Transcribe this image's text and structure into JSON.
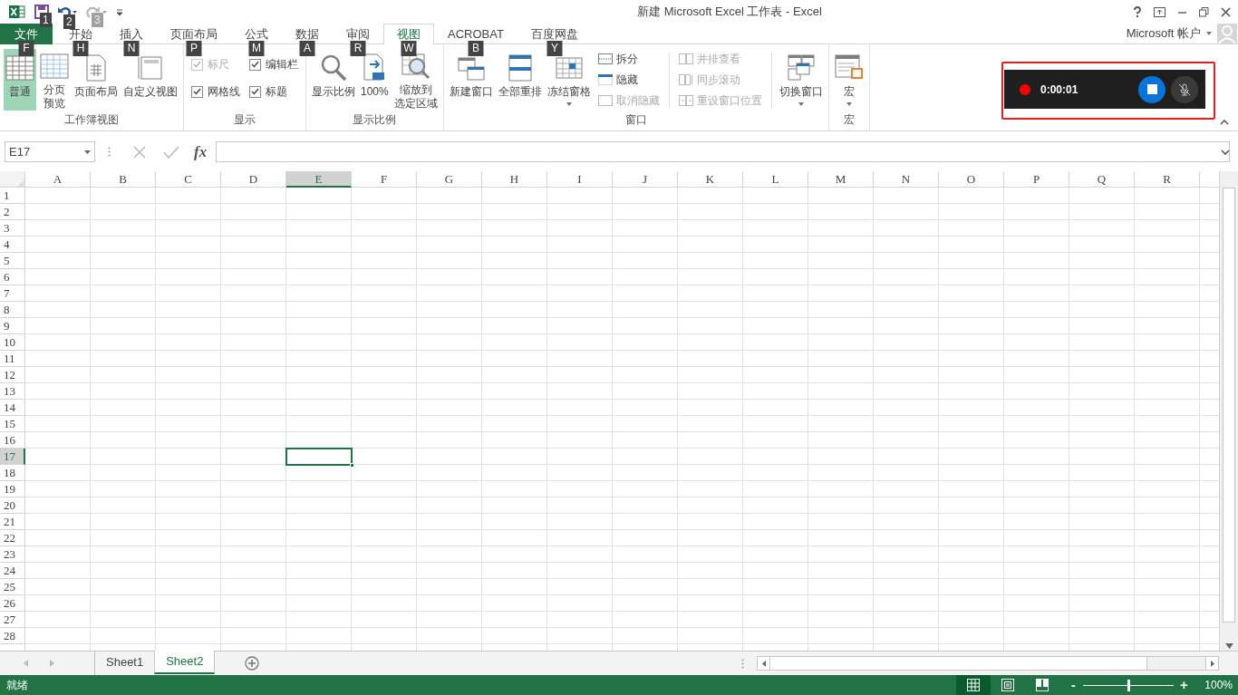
{
  "window": {
    "title": "新建 Microsoft Excel 工作表 - Excel"
  },
  "quick_access": [
    {
      "kind": "save",
      "keytip": "1",
      "disabled": false
    },
    {
      "kind": "undo",
      "keytip": "2",
      "disabled": false
    },
    {
      "kind": "redo",
      "keytip": "3",
      "disabled": true
    }
  ],
  "account": {
    "label": "Microsoft 帐户"
  },
  "tabs": [
    {
      "label": "文件",
      "keytip": "F",
      "selected": false,
      "kind": "file"
    },
    {
      "label": "开始",
      "keytip": "H",
      "selected": false,
      "kind": "tab"
    },
    {
      "label": "插入",
      "keytip": "N",
      "selected": false,
      "kind": "tab"
    },
    {
      "label": "页面布局",
      "keytip": "P",
      "selected": false,
      "kind": "tab"
    },
    {
      "label": "公式",
      "keytip": "M",
      "selected": false,
      "kind": "tab"
    },
    {
      "label": "数据",
      "keytip": "A",
      "selected": false,
      "kind": "tab"
    },
    {
      "label": "审阅",
      "keytip": "R",
      "selected": false,
      "kind": "tab"
    },
    {
      "label": "视图",
      "keytip": "W",
      "selected": true,
      "kind": "tab"
    },
    {
      "label": "ACROBAT",
      "keytip": "B",
      "selected": false,
      "kind": "tab"
    },
    {
      "label": "百度网盘",
      "keytip": "Y",
      "selected": false,
      "kind": "tab"
    }
  ],
  "ribbon": {
    "groups": [
      {
        "label": "工作簿视图",
        "items": [
          {
            "kind": "large",
            "label": "普通",
            "selected": true,
            "dropdown": false
          },
          {
            "kind": "large",
            "lines": [
              "分页",
              "预览"
            ],
            "selected": false,
            "dropdown": false
          },
          {
            "kind": "large",
            "label": "页面布局",
            "selected": false,
            "dropdown": false
          },
          {
            "kind": "large",
            "label": "自定义视图",
            "selected": false,
            "dropdown": false
          }
        ]
      },
      {
        "label": "显示",
        "items": [
          {
            "kind": "checks",
            "items": [
              {
                "label": "标尺",
                "checked": true,
                "disabled": true
              },
              {
                "label": "编辑栏",
                "checked": true,
                "disabled": false
              },
              {
                "label": "网格线",
                "checked": true,
                "disabled": false
              },
              {
                "label": "标题",
                "checked": true,
                "disabled": false
              }
            ]
          }
        ]
      },
      {
        "label": "显示比例",
        "items": [
          {
            "kind": "large",
            "label": "显示比例",
            "selected": false,
            "dropdown": false
          },
          {
            "kind": "large",
            "label": "100%",
            "selected": false,
            "dropdown": false
          },
          {
            "kind": "large",
            "lines": [
              "缩放到",
              "选定区域"
            ],
            "selected": false,
            "dropdown": false
          }
        ]
      },
      {
        "label": "窗口",
        "items": [
          {
            "kind": "large",
            "label": "新建窗口",
            "selected": false,
            "dropdown": false
          },
          {
            "kind": "large",
            "label": "全部重排",
            "selected": false,
            "dropdown": false
          },
          {
            "kind": "large",
            "label": "冻结窗格",
            "selected": false,
            "dropdown": true
          },
          {
            "kind": "small",
            "items": [
              {
                "label": "拆分",
                "disabled": false
              },
              {
                "label": "隐藏",
                "disabled": false
              },
              {
                "label": "取消隐藏",
                "disabled": true
              }
            ]
          },
          {
            "kind": "separator"
          },
          {
            "kind": "small",
            "items": [
              {
                "label": "并排查看",
                "disabled": true
              },
              {
                "label": "同步滚动",
                "disabled": true
              },
              {
                "label": "重设窗口位置",
                "disabled": true
              }
            ]
          },
          {
            "kind": "separator"
          },
          {
            "kind": "large",
            "label": "切换窗口",
            "selected": false,
            "dropdown": true
          }
        ]
      },
      {
        "label": "宏",
        "items": [
          {
            "kind": "large",
            "label": "宏",
            "selected": false,
            "dropdown": true
          }
        ]
      }
    ]
  },
  "recorder": {
    "recording": true,
    "time": "0:00:01",
    "mic_muted": true
  },
  "formula_bar": {
    "name_box": "E17",
    "fx": "fx"
  },
  "grid": {
    "columns": [
      {
        "label": "A",
        "selected": false
      },
      {
        "label": "B",
        "selected": false
      },
      {
        "label": "C",
        "selected": false
      },
      {
        "label": "D",
        "selected": false
      },
      {
        "label": "E",
        "selected": true
      },
      {
        "label": "F",
        "selected": false
      },
      {
        "label": "G",
        "selected": false
      },
      {
        "label": "H",
        "selected": false
      },
      {
        "label": "I",
        "selected": false
      },
      {
        "label": "J",
        "selected": false
      },
      {
        "label": "K",
        "selected": false
      },
      {
        "label": "L",
        "selected": false
      },
      {
        "label": "M",
        "selected": false
      },
      {
        "label": "N",
        "selected": false
      },
      {
        "label": "O",
        "selected": false
      },
      {
        "label": "P",
        "selected": false
      },
      {
        "label": "Q",
        "selected": false
      },
      {
        "label": "R",
        "selected": false
      }
    ],
    "rows": [
      {
        "label": "1",
        "selected": false
      },
      {
        "label": "2",
        "selected": false
      },
      {
        "label": "3",
        "selected": false
      },
      {
        "label": "4",
        "selected": false
      },
      {
        "label": "5",
        "selected": false
      },
      {
        "label": "6",
        "selected": false
      },
      {
        "label": "7",
        "selected": false
      },
      {
        "label": "8",
        "selected": false
      },
      {
        "label": "9",
        "selected": false
      },
      {
        "label": "10",
        "selected": false
      },
      {
        "label": "11",
        "selected": false
      },
      {
        "label": "12",
        "selected": false
      },
      {
        "label": "13",
        "selected": false
      },
      {
        "label": "14",
        "selected": false
      },
      {
        "label": "15",
        "selected": false
      },
      {
        "label": "16",
        "selected": false
      },
      {
        "label": "17",
        "selected": true
      },
      {
        "label": "18",
        "selected": false
      },
      {
        "label": "19",
        "selected": false
      },
      {
        "label": "20",
        "selected": false
      },
      {
        "label": "21",
        "selected": false
      },
      {
        "label": "22",
        "selected": false
      },
      {
        "label": "23",
        "selected": false
      },
      {
        "label": "24",
        "selected": false
      },
      {
        "label": "25",
        "selected": false
      },
      {
        "label": "26",
        "selected": false
      },
      {
        "label": "27",
        "selected": false
      },
      {
        "label": "28",
        "selected": false
      }
    ]
  },
  "sheets": [
    {
      "label": "Sheet1",
      "selected": false
    },
    {
      "label": "Sheet2",
      "selected": true
    }
  ],
  "status_bar": {
    "status": "就绪",
    "views": [
      {
        "selected": true
      },
      {
        "selected": false
      },
      {
        "selected": false
      }
    ],
    "zoom_out": "-",
    "zoom_in": "+",
    "zoom_slider": {
      "level": 0.5
    },
    "zoom": "100%"
  }
}
